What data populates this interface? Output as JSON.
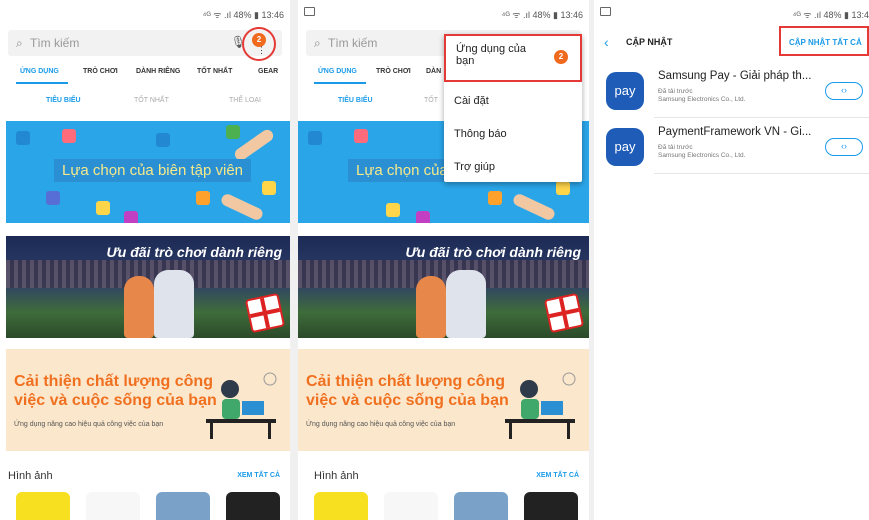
{
  "status": {
    "left_icon": "image-icon",
    "text": "⁴ᴳ ᯤ .ıl 48% ▮ 13:46",
    "text_short": "⁴ᴳ ᯤ .ıl 48% ▮ 13:4"
  },
  "search": {
    "placeholder": "Tìm kiếm",
    "icon": "search-icon",
    "mic": "mic-icon"
  },
  "notification_badge": "2",
  "tabs": [
    "ỨNG DỤNG",
    "TRÒ CHƠI",
    "DÀNH RIÊNG",
    "TỐT NHẤT",
    "GEAR"
  ],
  "tabs_short": [
    "ỨNG DỤNG",
    "TRÒ CHƠI",
    "DÀN"
  ],
  "subtabs": [
    "TIÊU BIỂU",
    "TỐT NHẤT",
    "THỂ LOẠI"
  ],
  "subtabs_short": [
    "TIÊU BIỂU",
    "TỐT"
  ],
  "banners": {
    "editor_choice": "Lựa chọn của biên tập viên",
    "editor_choice_cut": "Lựa chọn của",
    "games": "Ưu đãi trò chơi dành riêng",
    "productivity_line1": "Cải thiện chất lượng công",
    "productivity_line2": "việc và cuộc sống của bạn",
    "productivity_sub": "Ứng dụng nâng cao hiệu quả công việc của bạn"
  },
  "section": {
    "title": "Hình ảnh",
    "see_all": "XEM TẤT CẢ"
  },
  "menu": {
    "items": [
      "Ứng dụng của bạn",
      "Cài đặt",
      "Thông báo",
      "Trợ giúp"
    ],
    "badge": "2"
  },
  "updates": {
    "title": "CẬP NHẬT",
    "update_all": "CẬP NHẬT TẤT CẢ",
    "apps": [
      {
        "icon_text": "pay",
        "name": "Samsung Pay - Giải pháp th...",
        "status": "Đã tải trước",
        "developer": "Samsung Electronics Co., Ltd.",
        "button": "‹›"
      },
      {
        "icon_text": "pay",
        "name": "PaymentFramework VN - Gi...",
        "status": "Đã tải trước",
        "developer": "Samsung Electronics Co., Ltd.",
        "button": "‹›"
      }
    ]
  },
  "colors": {
    "accent": "#1a9be8",
    "badge": "#f06a1e",
    "highlight": "#e53935",
    "banner_orange": "#f07020",
    "pay_blue": "#1e5cb8"
  }
}
